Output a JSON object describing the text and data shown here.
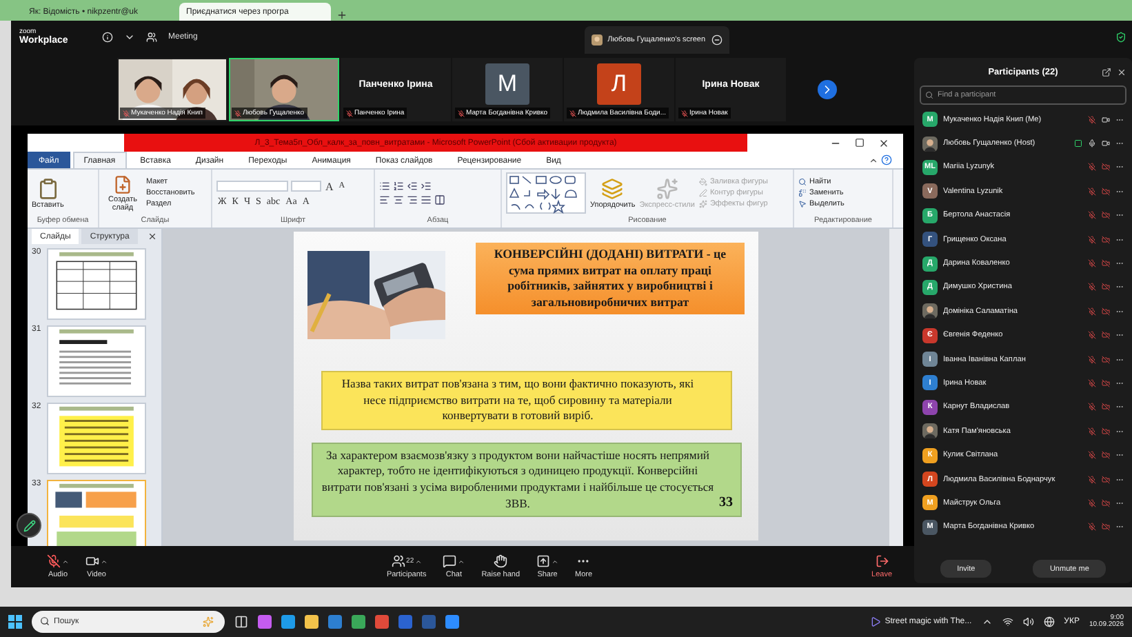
{
  "browser_tabs": [
    {
      "label": "Як: Відомість • nikpzentr@uk",
      "selected": false
    },
    {
      "label": "Приєднатися через програ",
      "selected": true
    }
  ],
  "zoom_header": {
    "brand_top": "zoom",
    "brand_bottom": "Workplace",
    "meeting": "Meeting",
    "share_tab": "Любовь Гущаленко's screen"
  },
  "video_strip": [
    {
      "kind": "video",
      "label": "Мукаченко Надія Книп",
      "speaking": false
    },
    {
      "kind": "video",
      "label": "Любовь Гущаленко",
      "speaking": true
    },
    {
      "kind": "name",
      "name": "Панченко Ірина",
      "label": "Панченко Ірина"
    },
    {
      "kind": "avatar",
      "initial": "M",
      "color": "#4a5662",
      "label": "Марта Богданівна Кривко"
    },
    {
      "kind": "avatar",
      "initial": "Л",
      "color": "#c4421a",
      "label": "Людмила Василівна Боди..."
    },
    {
      "kind": "name",
      "name": "Ірина Новак",
      "label": "Ірина Новак"
    }
  ],
  "powerpoint": {
    "title": "Л_3_Тема5п_Обл_калк_за_повн_витратами  -  Microsoft PowerPoint (Сбой активации продукта)",
    "tabs": [
      {
        "label": "Файл",
        "kind": "file",
        "selected": false
      },
      {
        "label": "Главная",
        "kind": "tab",
        "selected": true
      },
      {
        "label": "Вставка",
        "kind": "tab",
        "selected": false
      },
      {
        "label": "Дизайн",
        "kind": "tab",
        "selected": false
      },
      {
        "label": "Переходы",
        "kind": "tab",
        "selected": false
      },
      {
        "label": "Анимация",
        "kind": "tab",
        "selected": false
      },
      {
        "label": "Показ слайдов",
        "kind": "tab",
        "selected": false
      },
      {
        "label": "Рецензирование",
        "kind": "tab",
        "selected": false
      },
      {
        "label": "Вид",
        "kind": "tab",
        "selected": false
      }
    ],
    "ribbon": {
      "paste": "Вставить",
      "new_slide": "Создать слайд",
      "slide_commands": [
        "Макет",
        "Восстановить",
        "Раздел"
      ],
      "grow_shrink": [
        "A",
        "A"
      ],
      "font_buttons": [
        "Ж",
        "К",
        "Ч",
        "S",
        "abc",
        "Aa",
        "A"
      ],
      "arrange": "Упорядочить",
      "quick_styles": {
        "label": "Экспресс-стили",
        "disabled": true
      },
      "shape_commands": [
        {
          "label": "Заливка фигуры",
          "disabled": true
        },
        {
          "label": "Контур фигуры",
          "disabled": true
        },
        {
          "label": "Эффекты фигур",
          "disabled": true
        }
      ],
      "editing_commands": [
        "Найти",
        "Заменить",
        "Выделить"
      ],
      "group_labels": [
        "Буфер обмена",
        "Слайды",
        "Шрифт",
        "Абзац",
        "Рисование",
        "Редактирование"
      ]
    },
    "slides_pane": {
      "tabs": [
        {
          "label": "Слайды",
          "selected": true
        },
        {
          "label": "Структура",
          "selected": false
        }
      ],
      "thumbnails": [
        {
          "number": "30",
          "kind": "table",
          "selected": false
        },
        {
          "number": "31",
          "kind": "text",
          "selected": false
        },
        {
          "number": "32",
          "kind": "yellow",
          "selected": false
        },
        {
          "number": "33",
          "kind": "mixed",
          "selected": true
        }
      ]
    },
    "slide": {
      "heading": "КОНВЕРСІЙНІ (ДОДАНІ) ВИТРАТИ - це сума прямих витрат на оплату праці робітників, зайнятих у виробництві і загальновиробничих витрат",
      "boxes": [
        {
          "text": "Назва таких витрат пов'язана з тим, що вони фактично показують, які несе підприємство витрати на те, щоб сировину та матеріали конвертувати в готовий виріб.",
          "color": "#fbe45a"
        },
        {
          "text": "За характером взаємозв'язку з продуктом вони найчастіше носять непрямий характер, тобто не ідентифікуються з одиницею продукції. Конверсійні витрати пов'язані з усіма виробленими продуктами і найбільше це стосується ЗВВ.",
          "color": "#b2d88a"
        }
      ],
      "page_number": "33"
    }
  },
  "participants": {
    "title": "Participants (22)",
    "search_placeholder": "Find a participant",
    "list": [
      {
        "name": "Мукаченко Надія Книп (Me)",
        "kind": "initial",
        "initial": "M",
        "color": "#27a86a",
        "mic_on": false,
        "video_on": true,
        "sharing": false
      },
      {
        "name": "Любовь Гущаленко (Host)",
        "mic_on": true,
        "video_on": true,
        "sharing": true
      },
      {
        "name": "Mariia Lyzunyk",
        "kind": "initial",
        "initial": "ML",
        "color": "#27a86a",
        "mic_on": false,
        "video_on": false,
        "sharing": false
      },
      {
        "name": "Valentina Lyzunik",
        "kind": "initial",
        "initial": "V",
        "color": "#8a6a5c",
        "mic_on": false,
        "video_on": false,
        "sharing": false
      },
      {
        "name": "Бертола Анастасія",
        "kind": "initial",
        "initial": "Б",
        "color": "#27a86a",
        "mic_on": false,
        "video_on": false,
        "sharing": false
      },
      {
        "name": "Грищенко Оксана",
        "kind": "initial",
        "initial": "Г",
        "color": "#34527e",
        "mic_on": false,
        "video_on": false,
        "sharing": false
      },
      {
        "name": "Дарина Коваленко",
        "kind": "initial",
        "initial": "Д",
        "color": "#27a86a",
        "mic_on": false,
        "video_on": false,
        "sharing": false
      },
      {
        "name": "Димушко Христина",
        "kind": "initial",
        "initial": "Д",
        "color": "#27a86a",
        "mic_on": false,
        "video_on": false,
        "sharing": false
      },
      {
        "name": "Домініка Саламатіна",
        "mic_on": false,
        "video_on": false,
        "sharing": false
      },
      {
        "name": "Євгенія Феденко",
        "kind": "initial",
        "initial": "Є",
        "color": "#c9382c",
        "mic_on": false,
        "video_on": false,
        "sharing": false
      },
      {
        "name": "Іванна Іванівна Каплан",
        "kind": "initial",
        "initial": "І",
        "color": "#6f8596",
        "mic_on": false,
        "video_on": false,
        "sharing": false
      },
      {
        "name": "Ірина Новак",
        "kind": "initial",
        "initial": "І",
        "color": "#2e7fd0",
        "mic_on": false,
        "video_on": false,
        "sharing": false
      },
      {
        "name": "Карнут Владислав",
        "kind": "initial",
        "initial": "К",
        "color": "#8e44ad",
        "mic_on": false,
        "video_on": false,
        "sharing": false
      },
      {
        "name": "Катя Пам'яновська",
        "mic_on": false,
        "video_on": false,
        "sharing": false
      },
      {
        "name": "Кулик Світлана",
        "kind": "initial",
        "initial": "К",
        "color": "#f0a020",
        "mic_on": false,
        "video_on": false,
        "sharing": false
      },
      {
        "name": "Людмила Василівна Боднарчук",
        "kind": "initial",
        "initial": "Л",
        "color": "#d4461f",
        "mic_on": false,
        "video_on": false,
        "sharing": false
      },
      {
        "name": "Майструк Ольга",
        "kind": "initial",
        "initial": "М",
        "color": "#f0a020",
        "mic_on": false,
        "video_on": false,
        "sharing": false
      },
      {
        "name": "Марта Богданівна Кривко",
        "kind": "initial",
        "initial": "М",
        "color": "#4a5662",
        "mic_on": false,
        "video_on": false,
        "sharing": false
      }
    ],
    "buttons": [
      "Invite",
      "Unmute me"
    ]
  },
  "toolbar": [
    {
      "kind": "audio",
      "label": "Audio",
      "muted": true
    },
    {
      "kind": "video",
      "label": "Video"
    },
    {
      "kind": "participants",
      "label": "Participants",
      "count": "22"
    },
    {
      "kind": "chat",
      "label": "Chat"
    },
    {
      "kind": "raise_hand",
      "label": "Raise hand"
    },
    {
      "kind": "share",
      "label": "Share"
    },
    {
      "kind": "more",
      "label": "More"
    },
    {
      "kind": "leave",
      "label": "Leave"
    }
  ],
  "taskbar": {
    "search_placeholder": "Пошук",
    "media": "Street magic with The...",
    "language": "УКР",
    "time": "9:00",
    "date": "10.09.2026"
  }
}
